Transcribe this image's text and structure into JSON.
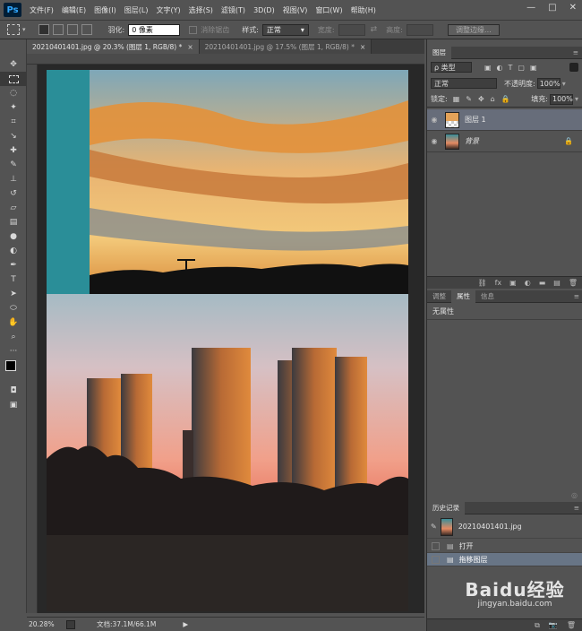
{
  "app": {
    "logo": "Ps"
  },
  "menu": [
    "文件(F)",
    "编辑(E)",
    "图像(I)",
    "图层(L)",
    "文字(Y)",
    "选择(S)",
    "滤镜(T)",
    "3D(D)",
    "视图(V)",
    "窗口(W)",
    "帮助(H)"
  ],
  "window_controls": {
    "minimize": "—",
    "maximize": "□",
    "close": "✕"
  },
  "options": {
    "feather_label": "羽化:",
    "feather_value": "0 像素",
    "antialias_label": "消除锯齿",
    "style_label": "样式:",
    "style_value": "正常",
    "width_label": "宽度:",
    "height_label": "高度:",
    "refine_button": "调整边缘..."
  },
  "tabs": [
    {
      "label": "20210401401.jpg @ 20.3% (图层 1, RGB/8) *",
      "close": "×"
    },
    {
      "label": "20210401401.jpg @ 17.5% (图层 1, RGB/8) *",
      "close": "×"
    }
  ],
  "status": {
    "zoom": "20.28%",
    "doc": "文档:37.1M/66.1M"
  },
  "layers_panel": {
    "title": "图层",
    "filter_label": "ρ 类型",
    "blend_mode": "正常",
    "opacity_label": "不透明度:",
    "opacity_value": "100%",
    "lock_label": "锁定:",
    "fill_label": "填充:",
    "fill_value": "100%",
    "layers": [
      {
        "name": "图层 1",
        "selected": true
      },
      {
        "name": "背景",
        "selected": false
      }
    ]
  },
  "properties_panel": {
    "tabs": [
      "调整",
      "属性",
      "信息"
    ],
    "content": "无属性"
  },
  "history_panel": {
    "title": "历史记录",
    "snapshot": "20210401401.jpg",
    "items": [
      {
        "label": "打开",
        "selected": false
      },
      {
        "label": "拖移图层",
        "selected": true
      }
    ]
  },
  "watermark": {
    "brand": "Baidu经验",
    "url": "jingyan.baidu.com"
  },
  "colors": {
    "accent": "#e8262b",
    "selected_layer": "#676d7a"
  }
}
